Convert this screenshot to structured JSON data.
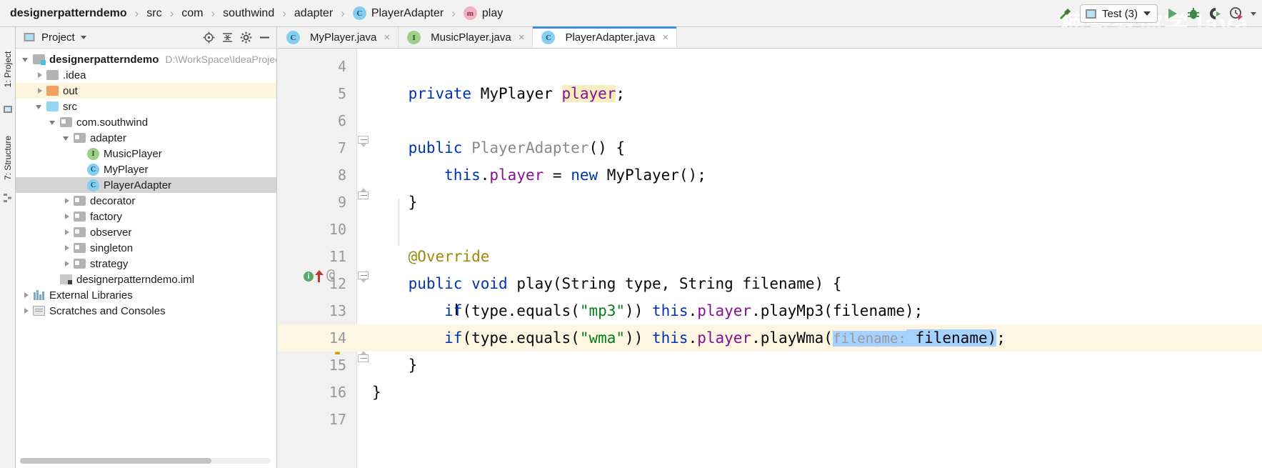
{
  "breadcrumb": {
    "items": [
      {
        "label": "designerpatterndemo",
        "badge": null,
        "bold": true
      },
      {
        "label": "src",
        "badge": null,
        "bold": false
      },
      {
        "label": "com",
        "badge": null,
        "bold": false
      },
      {
        "label": "southwind",
        "badge": null,
        "bold": false
      },
      {
        "label": "adapter",
        "badge": null,
        "bold": false
      },
      {
        "label": "PlayerAdapter",
        "badge": "C",
        "bold": false
      },
      {
        "label": "play",
        "badge": "m",
        "bold": false
      }
    ],
    "separator": "›"
  },
  "toolbar": {
    "build_icon": "hammer-icon",
    "run_config": {
      "label": "Test (3)",
      "icon": "run-config-icon",
      "caret": "▾"
    },
    "run_label": "run-icon",
    "debug_label": "debug-icon",
    "coverage_label": "run-with-coverage-icon",
    "profile_label": "profiler-icon",
    "overflow_caret": "▾"
  },
  "watermark": "楠哥教你学Java",
  "tool_strips": {
    "left": [
      {
        "label": "1: Project",
        "name": "tool-window-project"
      },
      {
        "label": "7: Structure",
        "name": "tool-window-structure"
      }
    ]
  },
  "project_panel": {
    "title": "Project",
    "title_caret": "▾",
    "actions": [
      "locate-icon",
      "collapse-all-icon",
      "settings-gear-icon",
      "hide-icon"
    ],
    "tree": [
      {
        "label": "designerpatterndemo",
        "path": "D:\\WorkSpace\\IdeaProject",
        "indent": 0,
        "twist": "down",
        "icon": "module-icon",
        "bold": true,
        "state": "normal"
      },
      {
        "label": ".idea",
        "path": "",
        "indent": 1,
        "twist": "right",
        "icon": "folder-gray-icon",
        "bold": false,
        "state": "normal"
      },
      {
        "label": "out",
        "path": "",
        "indent": 1,
        "twist": "right",
        "icon": "folder-orange-icon",
        "bold": false,
        "state": "highlight"
      },
      {
        "label": "src",
        "path": "",
        "indent": 1,
        "twist": "down",
        "icon": "folder-blue-icon",
        "bold": false,
        "state": "normal"
      },
      {
        "label": "com.southwind",
        "path": "",
        "indent": 2,
        "twist": "down",
        "icon": "package-icon",
        "bold": false,
        "state": "normal"
      },
      {
        "label": "adapter",
        "path": "",
        "indent": 3,
        "twist": "down",
        "icon": "package-icon",
        "bold": false,
        "state": "normal"
      },
      {
        "label": "MusicPlayer",
        "path": "",
        "indent": 4,
        "twist": "none",
        "icon": "interface-badge",
        "bold": false,
        "state": "normal"
      },
      {
        "label": "MyPlayer",
        "path": "",
        "indent": 4,
        "twist": "none",
        "icon": "class-badge",
        "bold": false,
        "state": "normal"
      },
      {
        "label": "PlayerAdapter",
        "path": "",
        "indent": 4,
        "twist": "none",
        "icon": "class-badge",
        "bold": false,
        "state": "selected"
      },
      {
        "label": "decorator",
        "path": "",
        "indent": 3,
        "twist": "right",
        "icon": "package-icon",
        "bold": false,
        "state": "normal"
      },
      {
        "label": "factory",
        "path": "",
        "indent": 3,
        "twist": "right",
        "icon": "package-icon",
        "bold": false,
        "state": "normal"
      },
      {
        "label": "observer",
        "path": "",
        "indent": 3,
        "twist": "right",
        "icon": "package-icon",
        "bold": false,
        "state": "normal"
      },
      {
        "label": "singleton",
        "path": "",
        "indent": 3,
        "twist": "right",
        "icon": "package-icon",
        "bold": false,
        "state": "normal"
      },
      {
        "label": "strategy",
        "path": "",
        "indent": 3,
        "twist": "right",
        "icon": "package-icon",
        "bold": false,
        "state": "normal"
      },
      {
        "label": "designerpatterndemo.iml",
        "path": "",
        "indent": 2,
        "twist": "none",
        "icon": "iml-icon",
        "bold": false,
        "state": "normal"
      },
      {
        "label": "External Libraries",
        "path": "",
        "indent": 0,
        "twist": "right",
        "icon": "library-icon",
        "bold": false,
        "state": "normal"
      },
      {
        "label": "Scratches and Consoles",
        "path": "",
        "indent": 0,
        "twist": "right",
        "icon": "scratches-icon",
        "bold": false,
        "state": "normal"
      }
    ]
  },
  "editor_tabs": [
    {
      "label": "MyPlayer.java",
      "badge": "C",
      "badge_kind": "class",
      "active": false,
      "close": "×"
    },
    {
      "label": "MusicPlayer.java",
      "badge": "I",
      "badge_kind": "interface",
      "active": false,
      "close": "×"
    },
    {
      "label": "PlayerAdapter.java",
      "badge": "C",
      "badge_kind": "class",
      "active": true,
      "close": "×"
    }
  ],
  "editor": {
    "first_line": 4,
    "current_line": 14,
    "lines": [
      {
        "num": "4",
        "tokens": []
      },
      {
        "num": "5",
        "tokens": [
          {
            "t": "    ",
            "c": "pln"
          },
          {
            "t": "private",
            "c": "kw"
          },
          {
            "t": " MyPlayer ",
            "c": "pln"
          },
          {
            "t": "player",
            "c": "fld fieldhl"
          },
          {
            "t": ";",
            "c": "pln"
          }
        ]
      },
      {
        "num": "6",
        "tokens": []
      },
      {
        "num": "7",
        "tokens": [
          {
            "t": "    ",
            "c": "pln"
          },
          {
            "t": "public",
            "c": "kw"
          },
          {
            "t": " ",
            "c": "pln"
          },
          {
            "t": "PlayerAdapter",
            "c": "cls"
          },
          {
            "t": "() {",
            "c": "pln"
          }
        ]
      },
      {
        "num": "8",
        "tokens": [
          {
            "t": "        ",
            "c": "pln"
          },
          {
            "t": "this",
            "c": "kw"
          },
          {
            "t": ".",
            "c": "pln"
          },
          {
            "t": "player",
            "c": "fld"
          },
          {
            "t": " = ",
            "c": "pln"
          },
          {
            "t": "new",
            "c": "kw"
          },
          {
            "t": " MyPlayer();",
            "c": "pln"
          }
        ]
      },
      {
        "num": "9",
        "tokens": [
          {
            "t": "    }",
            "c": "pln"
          }
        ]
      },
      {
        "num": "10",
        "tokens": []
      },
      {
        "num": "11",
        "tokens": [
          {
            "t": "    ",
            "c": "pln"
          },
          {
            "t": "@Override",
            "c": "ann"
          }
        ]
      },
      {
        "num": "12",
        "tokens": [
          {
            "t": "    ",
            "c": "pln"
          },
          {
            "t": "public",
            "c": "kw"
          },
          {
            "t": " ",
            "c": "pln"
          },
          {
            "t": "void",
            "c": "kw"
          },
          {
            "t": " play",
            "c": "pln"
          },
          {
            "t": "(String type, String filename) {",
            "c": "pln"
          }
        ]
      },
      {
        "num": "13",
        "tokens": [
          {
            "t": "        ",
            "c": "pln"
          },
          {
            "t": "if",
            "c": "kw"
          },
          {
            "t": "(type.equals(",
            "c": "pln"
          },
          {
            "t": "\"mp3\"",
            "c": "str"
          },
          {
            "t": ")) ",
            "c": "pln"
          },
          {
            "t": "this",
            "c": "kw"
          },
          {
            "t": ".",
            "c": "pln"
          },
          {
            "t": "player",
            "c": "fld"
          },
          {
            "t": ".playMp3(filename);",
            "c": "pln"
          }
        ]
      },
      {
        "num": "14",
        "tokens": [
          {
            "t": "        ",
            "c": "pln"
          },
          {
            "t": "if",
            "c": "kw"
          },
          {
            "t": "(type.equals(",
            "c": "pln"
          },
          {
            "t": "\"wma\"",
            "c": "str"
          },
          {
            "t": ")) ",
            "c": "pln"
          },
          {
            "t": "this",
            "c": "kw"
          },
          {
            "t": ".",
            "c": "pln"
          },
          {
            "t": "player",
            "c": "fld"
          },
          {
            "t": ".playWma(",
            "c": "pln"
          },
          {
            "t": "filename:",
            "c": "hint selhl"
          },
          {
            "t": " filename)",
            "c": "pln selhl"
          },
          {
            "t": ";",
            "c": "pln"
          }
        ]
      },
      {
        "num": "15",
        "tokens": [
          {
            "t": "    }",
            "c": "pln"
          }
        ]
      },
      {
        "num": "16",
        "tokens": [
          {
            "t": "}",
            "c": "pln"
          }
        ]
      },
      {
        "num": "17",
        "tokens": []
      }
    ],
    "gutter_marks": {
      "line12_override": "override-method-icon",
      "line12_annotation": "@",
      "line12_info": "i",
      "line14_bulb": "intention-bulb-icon"
    }
  },
  "colors": {
    "keyword": "#0033b3",
    "string": "#067d17",
    "field": "#871094",
    "annotation": "#9e880d",
    "class": "#8a8a8a",
    "selection": "#a6d2ff",
    "current_line": "#fdf6e3",
    "tab_active_underline": "#3c8dde",
    "tree_selection": "#d4d4d4",
    "accent_green": "#59a869"
  }
}
